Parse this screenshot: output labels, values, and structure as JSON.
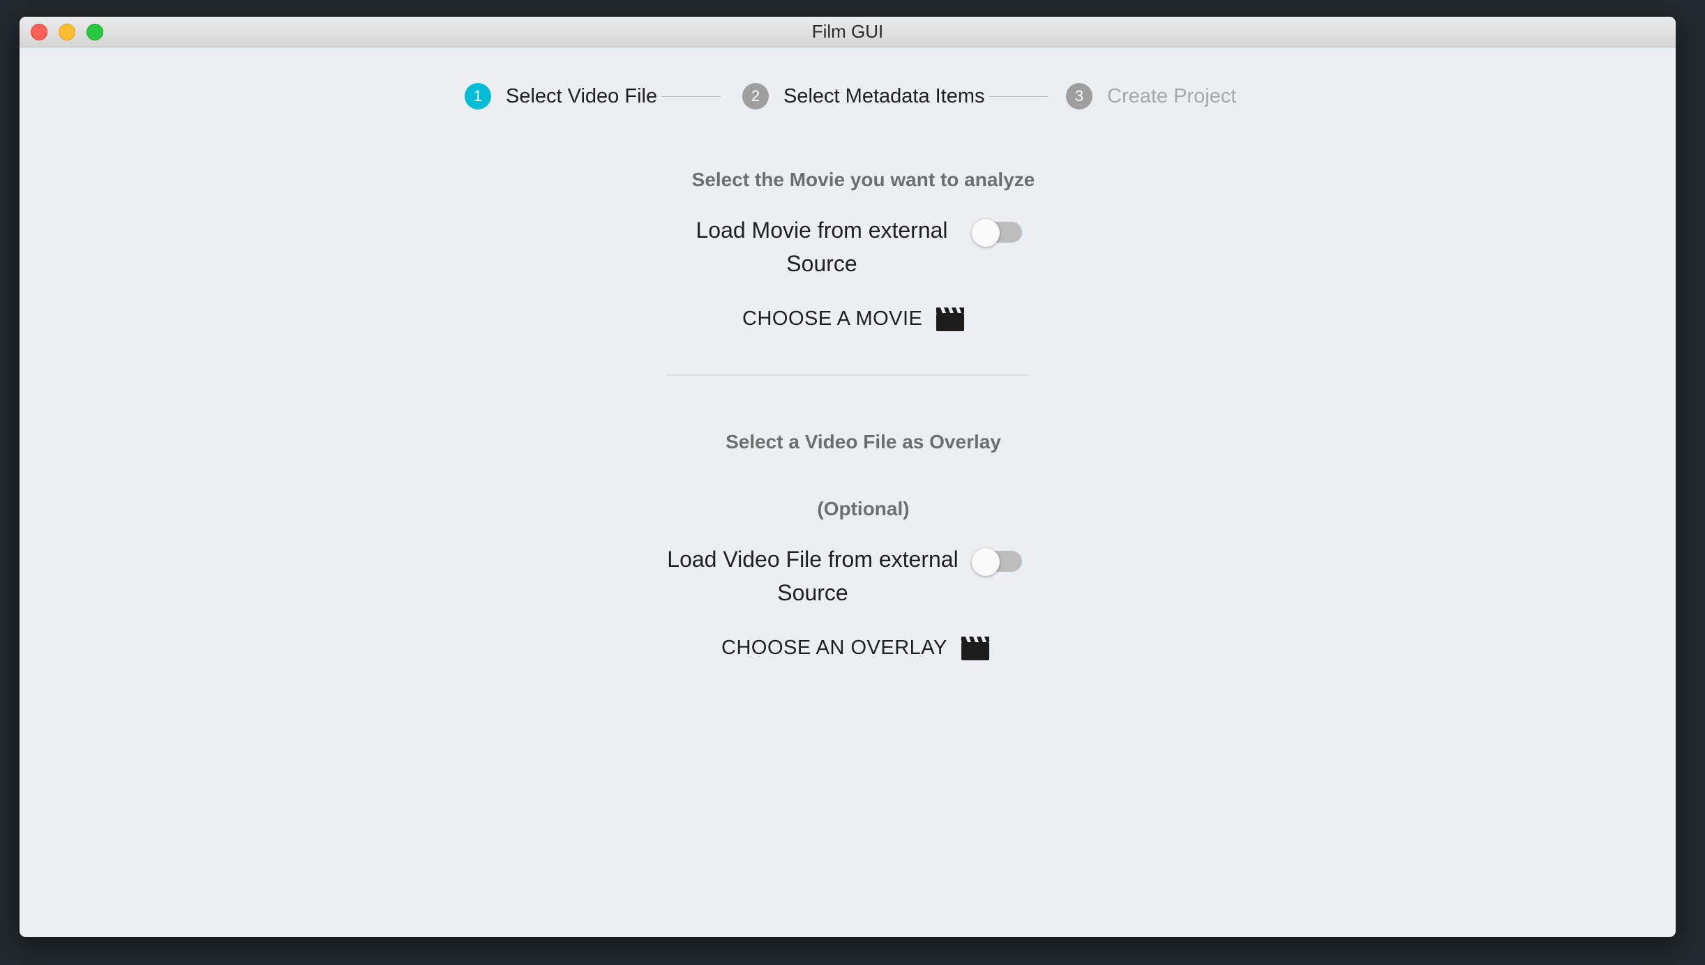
{
  "window": {
    "title": "Film GUI",
    "traffic_lights": [
      "close",
      "minimize",
      "maximize"
    ]
  },
  "stepper": {
    "steps": [
      {
        "number": "1",
        "label": "Select Video File",
        "state": "active",
        "color": "#00bcd4"
      },
      {
        "number": "2",
        "label": "Select Metadata Items",
        "state": "inactive",
        "color": "#9e9e9e"
      },
      {
        "number": "3",
        "label": "Create Project",
        "state": "disabled",
        "color": "#9e9e9e"
      }
    ]
  },
  "movie_section": {
    "heading": "Select the Movie you want to analyze",
    "toggle_label": "Load Movie from external Source",
    "toggle_on": false,
    "choose_button": "CHOOSE A MOVIE",
    "icon": "movie-clapperboard-icon"
  },
  "overlay_section": {
    "heading": "Select a Video File as Overlay",
    "optional_note": "(Optional)",
    "toggle_label": "Load Video File from external Source",
    "toggle_on": false,
    "choose_button": "CHOOSE AN OVERLAY",
    "icon": "movie-clapperboard-icon"
  },
  "colors": {
    "accent": "#00bcd4",
    "inactive_step": "#9e9e9e",
    "disabled_text": "#a8a8a8"
  }
}
